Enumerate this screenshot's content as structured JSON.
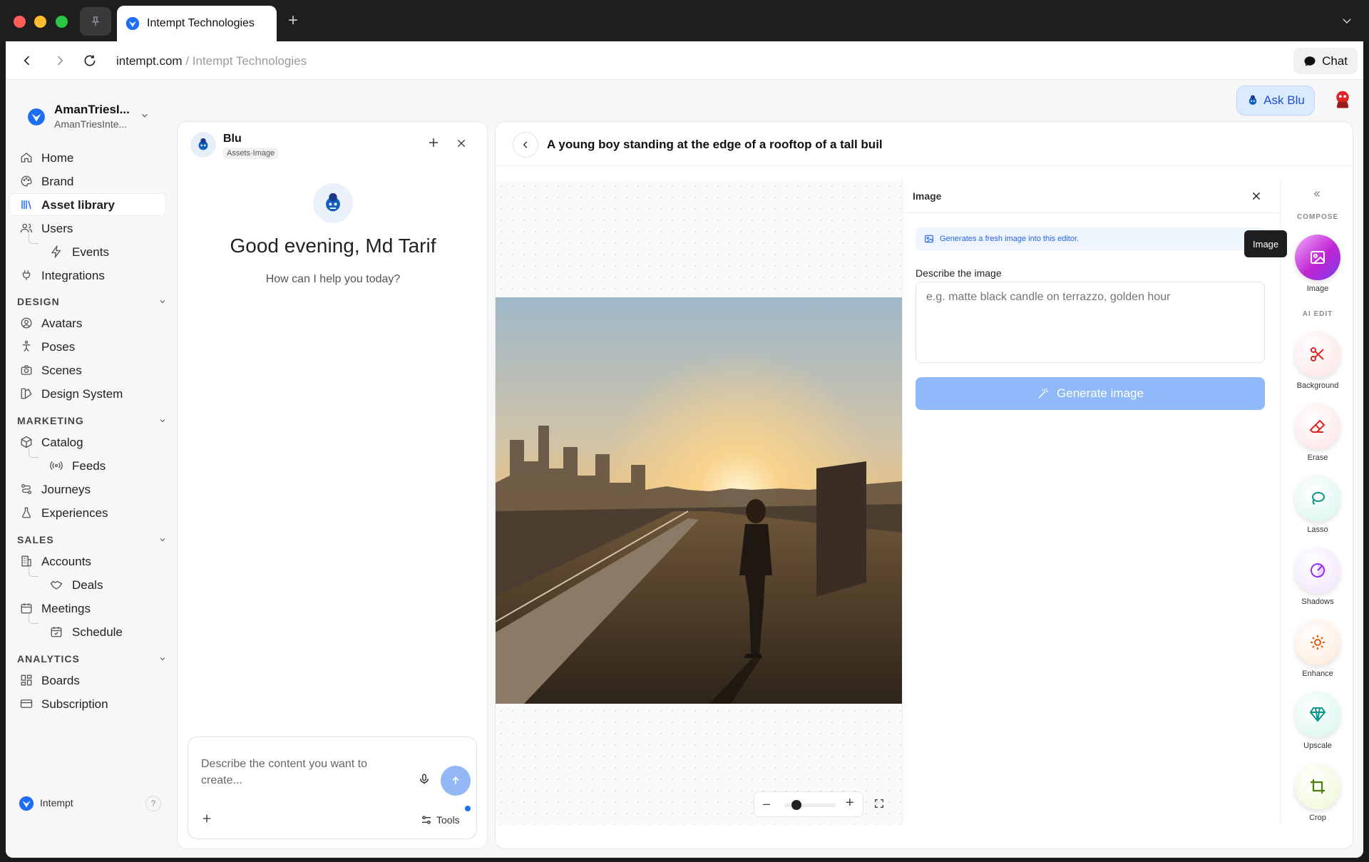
{
  "browser": {
    "tab_title": "Intempt Technologies",
    "url_domain": "intempt.com",
    "url_sep": " / ",
    "url_page": "Intempt Technologies",
    "chat_label": "Chat"
  },
  "workspace": {
    "name": "AmanTriesI...",
    "sub": "AmanTriesInte..."
  },
  "sidebar": {
    "top": [
      {
        "label": "Home",
        "icon": "home-icon"
      },
      {
        "label": "Brand",
        "icon": "palette-icon"
      },
      {
        "label": "Asset library",
        "icon": "library-icon",
        "active": true
      },
      {
        "label": "Users",
        "icon": "users-icon"
      },
      {
        "label": "Events",
        "icon": "lightning-icon",
        "sub": true
      },
      {
        "label": "Integrations",
        "icon": "plug-icon"
      }
    ],
    "design_title": "DESIGN",
    "design": [
      "Avatars",
      "Poses",
      "Scenes",
      "Design System"
    ],
    "marketing_title": "MARKETING",
    "marketing": [
      "Catalog",
      "Feeds",
      "Journeys",
      "Experiences"
    ],
    "sales_title": "SALES",
    "sales": [
      "Accounts",
      "Deals",
      "Meetings",
      "Schedule"
    ],
    "analytics_title": "ANALYTICS",
    "analytics": [
      "Boards",
      "Subscription"
    ],
    "footer_label": "Intempt",
    "help": "?"
  },
  "header": {
    "ask_label": "Ask Blu"
  },
  "blu": {
    "name": "Blu",
    "tag": "Assets·Image",
    "greeting": "Good evening, Md Tarif",
    "prompt": "How can I help you today?",
    "composer_placeholder": "Describe the content you want to create...",
    "tools_label": "Tools"
  },
  "editor": {
    "title": "A young boy standing at the edge of a rooftop of a tall buil",
    "panel_title": "Image",
    "info_text": "Generates a fresh image into this editor.",
    "tooltip": "Image",
    "describe_label": "Describe the image",
    "describe_placeholder": "e.g. matte black candle on terrazzo, golden hour",
    "generate_label": "Generate image",
    "zoom_out": "–",
    "zoom_in": "+"
  },
  "rail": {
    "compose_title": "COMPOSE",
    "ai_edit_title": "AI EDIT",
    "tools": [
      {
        "label": "Image",
        "icon": "image-icon",
        "color": "#c026d3"
      },
      {
        "label": "Background",
        "icon": "scissors-icon",
        "color": "#dc2626"
      },
      {
        "label": "Erase",
        "icon": "eraser-icon",
        "color": "#dc2626"
      },
      {
        "label": "Lasso",
        "icon": "lasso-icon",
        "color": "#0d9488"
      },
      {
        "label": "Shadows",
        "icon": "shadows-icon",
        "color": "#9333ea"
      },
      {
        "label": "Enhance",
        "icon": "sun-icon",
        "color": "#ea580c"
      },
      {
        "label": "Upscale",
        "icon": "diamond-icon",
        "color": "#0d9488"
      },
      {
        "label": "Crop",
        "icon": "crop-icon",
        "color": "#65a30d"
      }
    ]
  },
  "colors": {
    "accent": "#2563eb",
    "send_button": "#93b6f5",
    "generate_button": "#8fb9f8"
  }
}
